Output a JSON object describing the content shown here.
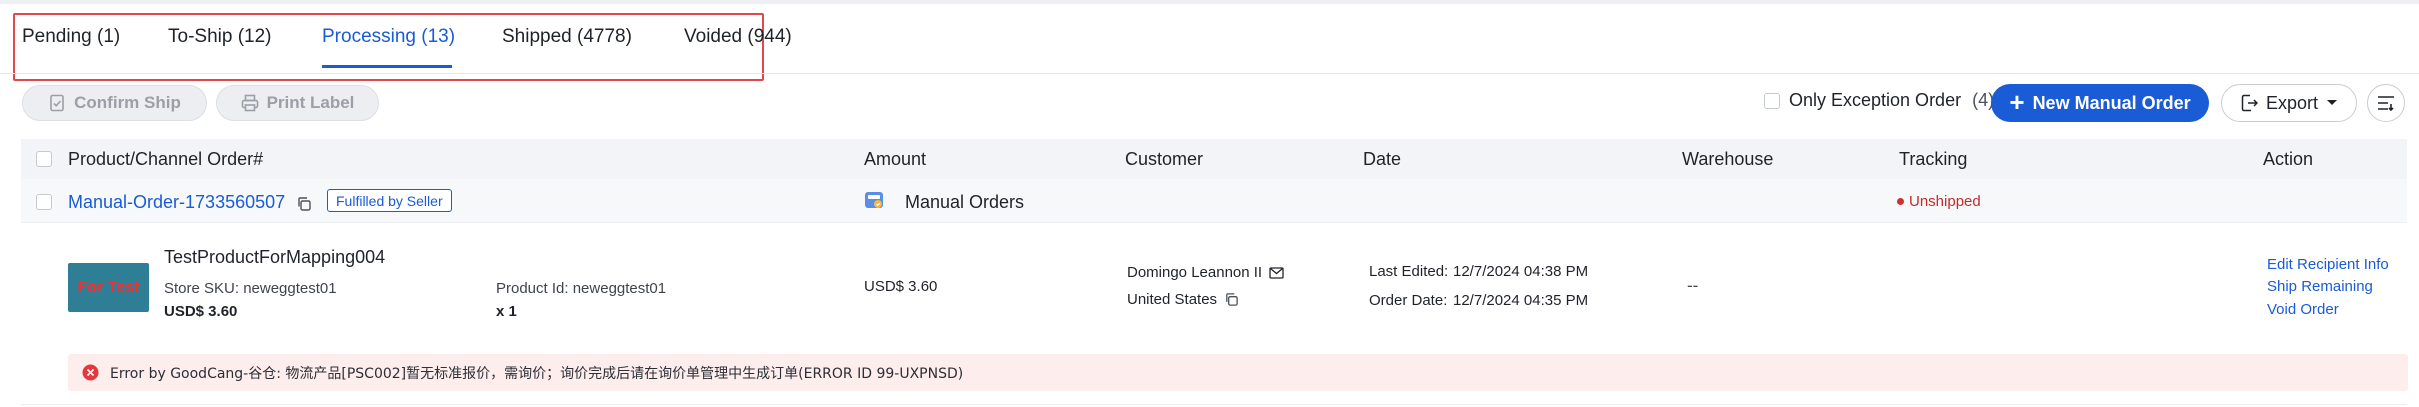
{
  "tabs": [
    {
      "label": "Pending (1)"
    },
    {
      "label": "To-Ship (12)"
    },
    {
      "label": "Processing (13)",
      "active": true
    },
    {
      "label": "Shipped (4778)"
    },
    {
      "label": "Voided (944)"
    }
  ],
  "toolbar": {
    "confirm_ship": "Confirm Ship",
    "print_label": "Print Label",
    "exception_label": "Only Exception Order",
    "exception_count": "(4)",
    "new_manual_order": "New Manual Order",
    "export": "Export"
  },
  "table": {
    "columns": [
      "Product/Channel Order#",
      "Amount",
      "Customer",
      "Date",
      "Warehouse",
      "Tracking",
      "Action"
    ]
  },
  "order": {
    "order_id": "Manual-Order-1733560507",
    "badge": "Fulfilled by Seller",
    "channel": "Manual Orders",
    "tracking_status": "Unshipped",
    "product": {
      "thumb_text": "For Test",
      "name": "TestProductForMapping004",
      "store_sku": "Store SKU: neweggtest01",
      "price": "USD$ 3.60",
      "product_id": "Product Id: neweggtest01",
      "quantity": "x 1"
    },
    "amount": "USD$ 3.60",
    "customer_name": "Domingo Leannon II",
    "customer_country": "United States",
    "last_edited_label": "Last Edited:",
    "last_edited_value": "12/7/2024 04:38 PM",
    "order_date_label": "Order Date:",
    "order_date_value": "12/7/2024 04:35 PM",
    "warehouse": "--",
    "actions": [
      "Edit Recipient Info",
      "Ship Remaining",
      "Void Order"
    ],
    "error": "Error by GoodCang-谷仓: 物流产品[PSC002]暂无标准报价，需询价；询价完成后请在询价单管理中生成订单(ERROR ID 99-UXPNSD)"
  },
  "colors": {
    "accent": "#1a5bd6",
    "tab_highlight_border": "#e0484e",
    "unshipped": "#c42b2b",
    "error_bg": "#fdeded"
  },
  "icons": [
    "document-check-icon",
    "printer-icon",
    "plus-icon",
    "export-icon",
    "caret-down-icon",
    "columns-settings-icon",
    "copy-icon",
    "manual-order-channel-icon",
    "mail-icon",
    "error-icon"
  ]
}
